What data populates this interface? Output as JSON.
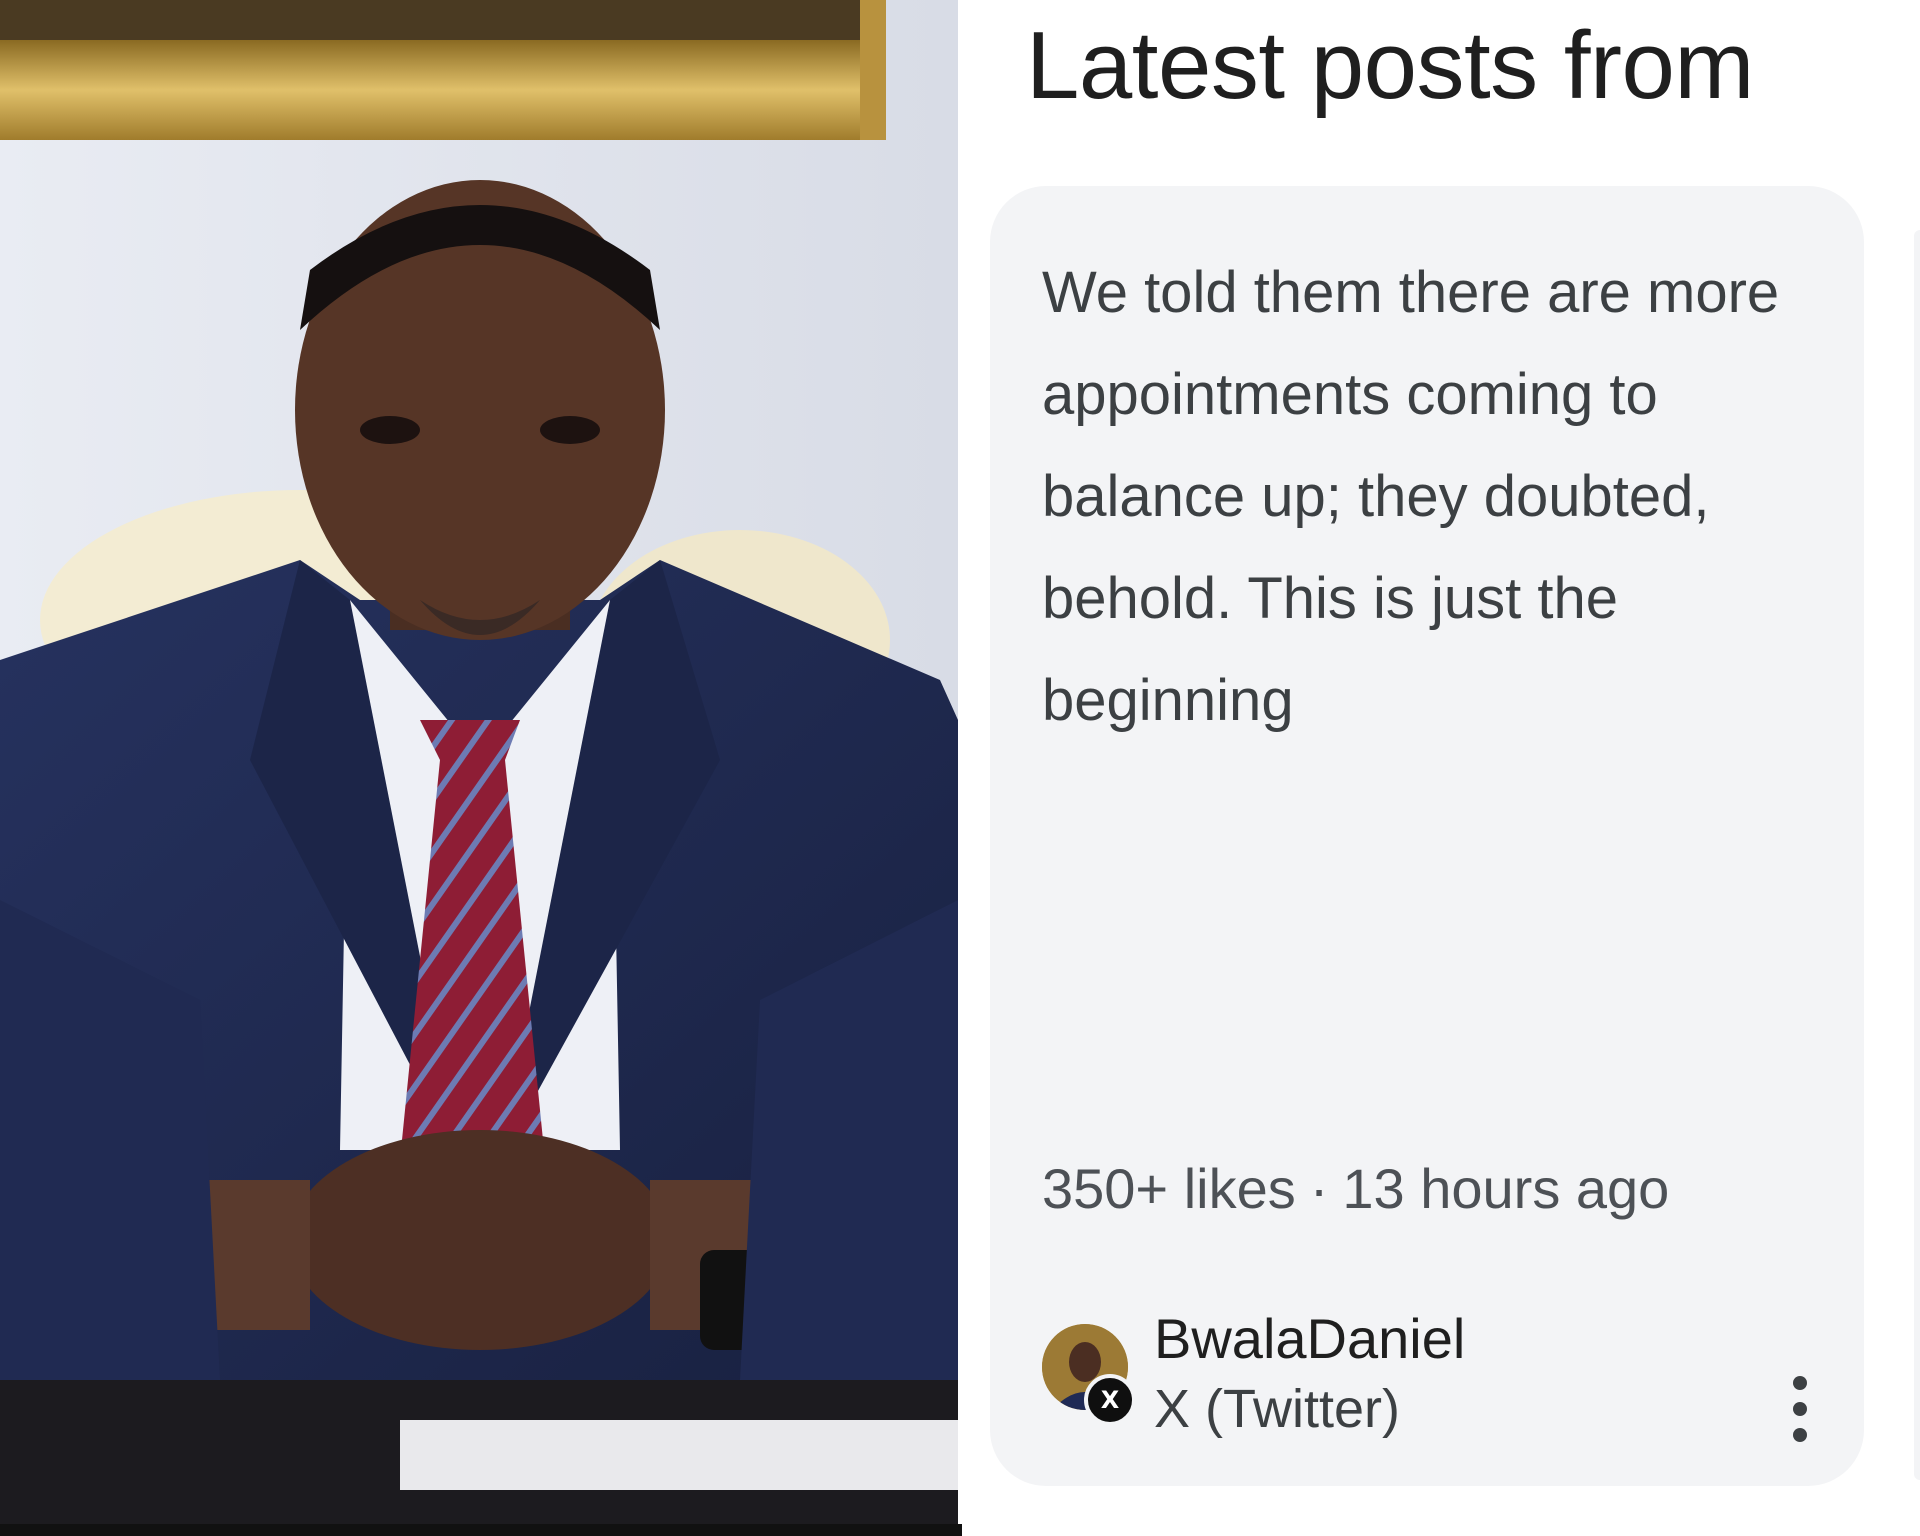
{
  "section": {
    "heading": "Latest posts from"
  },
  "post": {
    "text": "We told them there are more appointments coming to balance up; they doubted, behold. This is just the beginning",
    "likes": "350+ likes",
    "separator": "·",
    "time": "13 hours ago",
    "author": {
      "name": "BwalaDaniel",
      "source": "X (Twitter)",
      "badge_icon": "x-logo-icon",
      "badge_glyph": "X"
    },
    "menu_icon": "more-vertical-icon"
  },
  "colors": {
    "card_background": "#f3f4f6",
    "heading_text": "#1f1f1f",
    "body_text": "#3c4043",
    "meta_text": "#4d5156"
  }
}
